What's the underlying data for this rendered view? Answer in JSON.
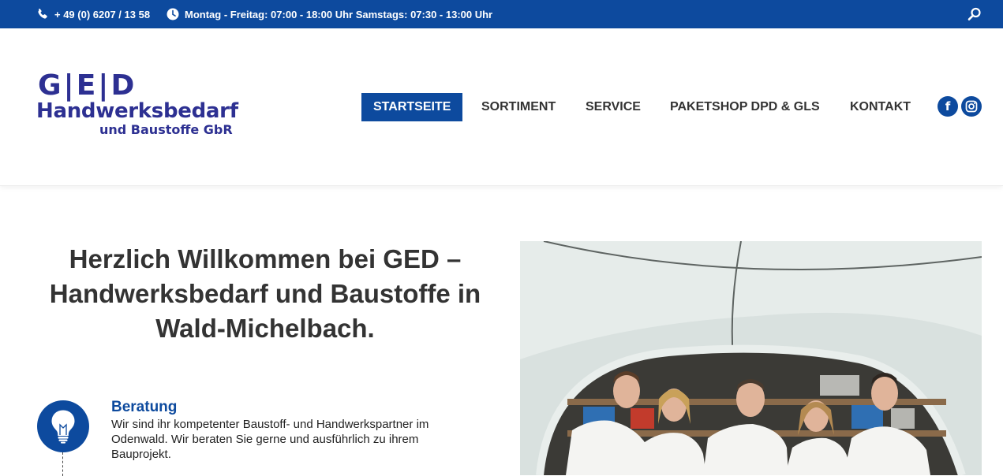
{
  "topbar": {
    "phone": "+ 49 (0) 6207 / 13 58",
    "hours": "Montag - Freitag: 07:00 - 18:00 Uhr Samstags: 07:30 - 13:00 Uhr",
    "phone_icon": "phone-icon",
    "clock_icon": "clock-icon",
    "search_icon": "search-icon"
  },
  "logo": {
    "line1": "G|E|D",
    "line2": "Handwerksbedarf",
    "line3": "und Baustoffe GbR"
  },
  "nav": {
    "items": [
      {
        "label": "STARTSEITE",
        "active": true
      },
      {
        "label": "SORTIMENT",
        "active": false
      },
      {
        "label": "SERVICE",
        "active": false
      },
      {
        "label": "PAKETSHOP DPD & GLS",
        "active": false
      },
      {
        "label": "KONTAKT",
        "active": false
      }
    ]
  },
  "social": {
    "facebook_icon": "facebook-icon",
    "facebook_glyph": "f",
    "instagram_icon": "instagram-icon"
  },
  "hero": {
    "headline": "Herzlich Willkommen bei GED – Handwerksbedarf und Baustoffe in Wald-Michelbach."
  },
  "features": [
    {
      "icon": "lightbulb-icon",
      "title": "Beratung",
      "text": "Wir sind ihr kompetenter Baustoff- und Handwerkspartner im Odenwald. Wir beraten Sie gerne und ausführlich zu ihrem Bauprojekt."
    }
  ],
  "colors": {
    "brand_blue": "#0d4a9e",
    "logo_blue": "#2d3092",
    "text_dark": "#333333"
  }
}
